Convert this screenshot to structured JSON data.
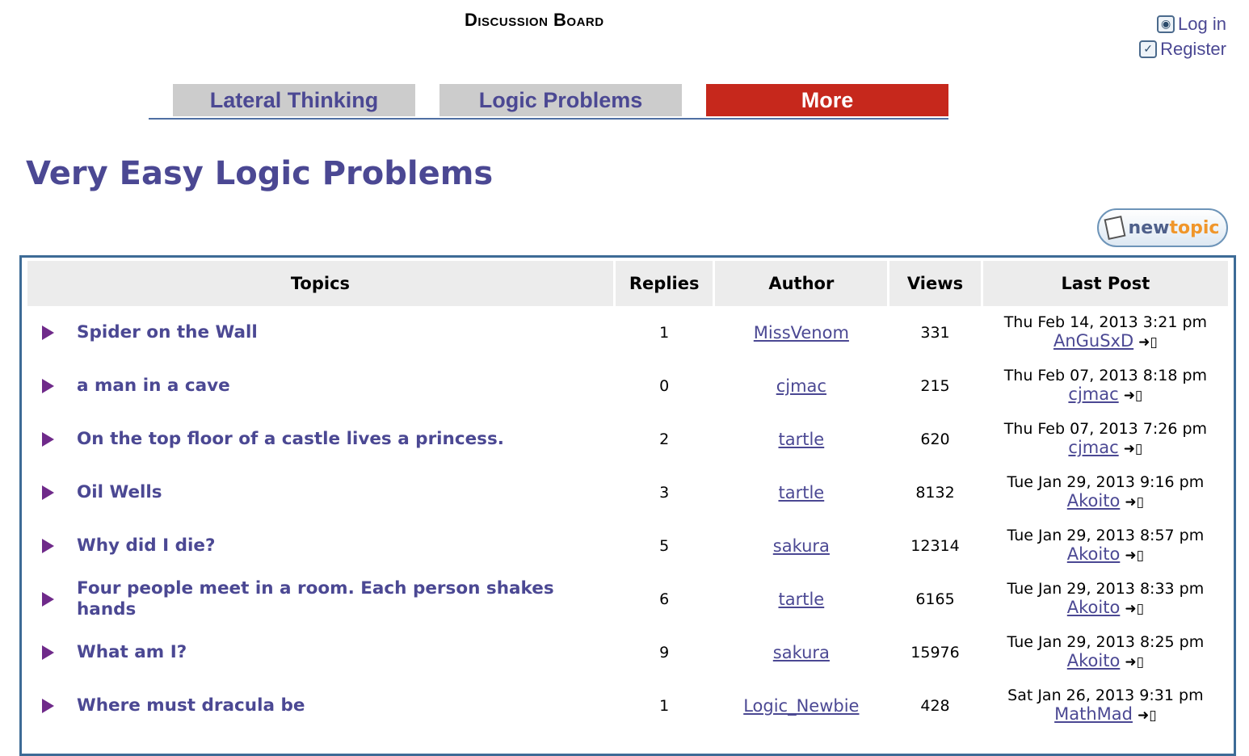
{
  "header": {
    "board_title": "Discussion Board",
    "login": "Log in",
    "register": "Register"
  },
  "tabs": [
    {
      "label": "Lateral Thinking",
      "active": false
    },
    {
      "label": "Logic Problems",
      "active": false
    },
    {
      "label": "More",
      "active": true
    }
  ],
  "page_title": "Very Easy Logic Problems",
  "new_topic": {
    "part1": "new",
    "part2": "topic"
  },
  "table": {
    "columns": [
      "Topics",
      "Replies",
      "Author",
      "Views",
      "Last Post"
    ],
    "rows": [
      {
        "topic": "Spider on the Wall",
        "replies": "1",
        "author": "MissVenom",
        "views": "331",
        "last_date": "Thu Feb 14, 2013 3:21 pm",
        "last_user": "AnGuSxD"
      },
      {
        "topic": "a man in a cave",
        "replies": "0",
        "author": "cjmac",
        "views": "215",
        "last_date": "Thu Feb 07, 2013 8:18 pm",
        "last_user": "cjmac"
      },
      {
        "topic": "On the top floor of a castle lives a princess.",
        "replies": "2",
        "author": "tartle",
        "views": "620",
        "last_date": "Thu Feb 07, 2013 7:26 pm",
        "last_user": "cjmac"
      },
      {
        "topic": "Oil Wells",
        "replies": "3",
        "author": "tartle",
        "views": "8132",
        "last_date": "Tue Jan 29, 2013 9:16 pm",
        "last_user": "Akoito"
      },
      {
        "topic": "Why did I die?",
        "replies": "5",
        "author": "sakura",
        "views": "12314",
        "last_date": "Tue Jan 29, 2013 8:57 pm",
        "last_user": "Akoito"
      },
      {
        "topic": "Four people meet in a room. Each person shakes hands",
        "replies": "6",
        "author": "tartle",
        "views": "6165",
        "last_date": "Tue Jan 29, 2013 8:33 pm",
        "last_user": "Akoito"
      },
      {
        "topic": "What am I?",
        "replies": "9",
        "author": "sakura",
        "views": "15976",
        "last_date": "Tue Jan 29, 2013 8:25 pm",
        "last_user": "Akoito"
      },
      {
        "topic": "Where must dracula be",
        "replies": "1",
        "author": "Logic_Newbie",
        "views": "428",
        "last_date": "Sat Jan 26, 2013 9:31 pm",
        "last_user": "MathMad"
      }
    ]
  }
}
